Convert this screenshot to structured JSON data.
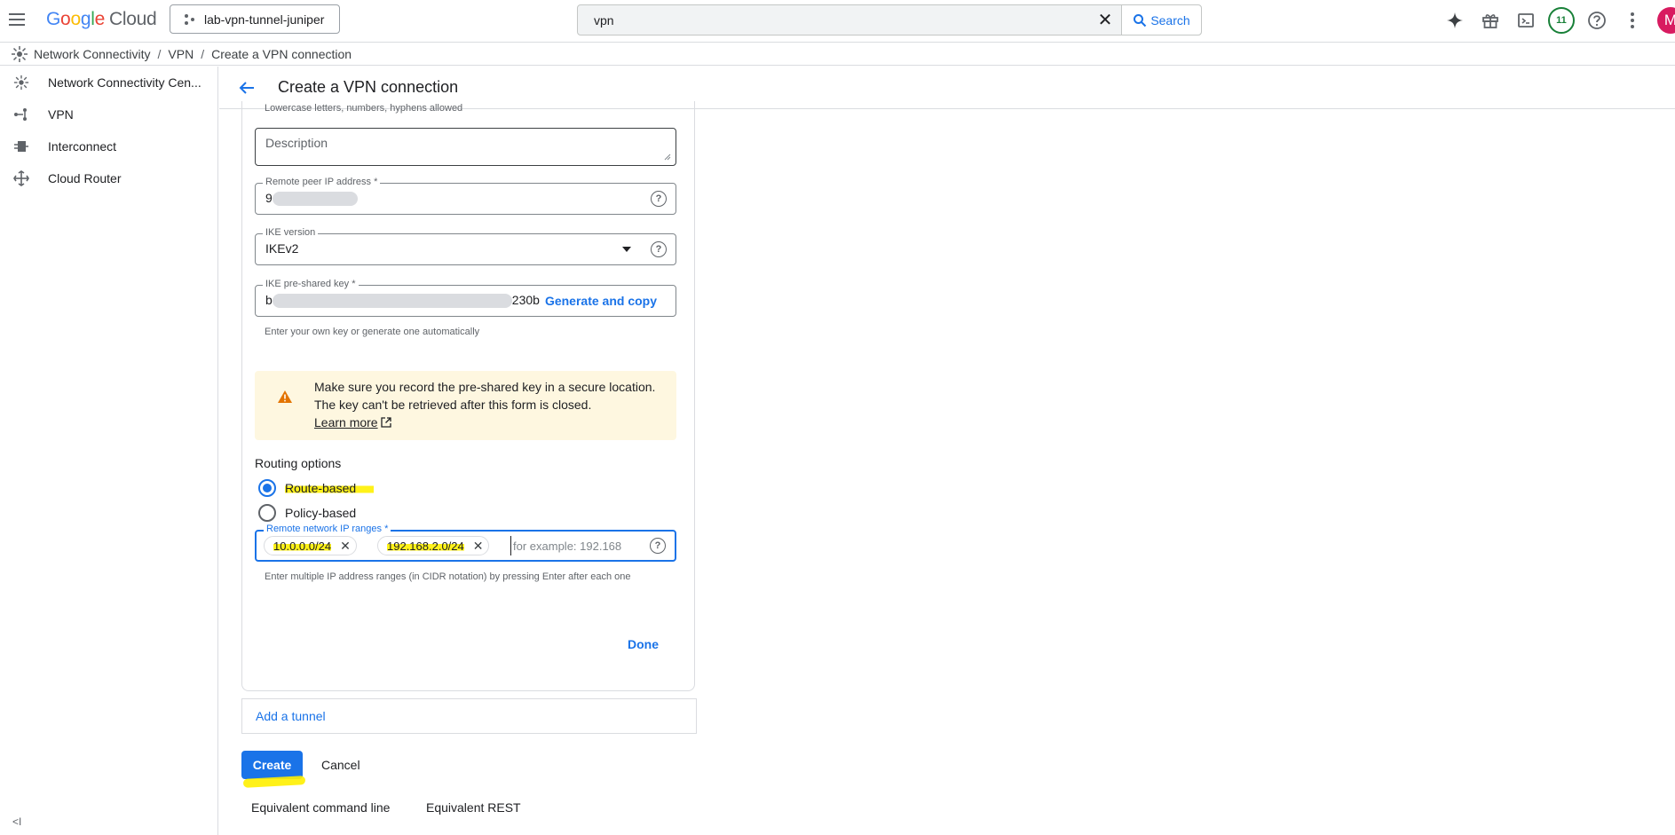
{
  "topbar": {
    "logo_google": [
      "G",
      "o",
      "o",
      "g",
      "l",
      "e"
    ],
    "logo_cloud": "Cloud",
    "project": "lab-vpn-tunnel-juniper",
    "search_value": "vpn",
    "search_button": "Search",
    "notification_count": "11",
    "avatar_initial": "M"
  },
  "breadcrumb": {
    "items": [
      "Network Connectivity",
      "VPN",
      "Create a VPN connection"
    ]
  },
  "sidebar": {
    "items": [
      {
        "label": "Network Connectivity Cen..."
      },
      {
        "label": "VPN"
      },
      {
        "label": "Interconnect"
      },
      {
        "label": "Cloud Router"
      }
    ],
    "collapse_label": "<I"
  },
  "header": {
    "title": "Create a VPN connection"
  },
  "form": {
    "name_hint": "Lowercase letters, numbers, hyphens allowed",
    "description_placeholder": "Description",
    "remote_peer_label": "Remote peer IP address *",
    "remote_peer_value_prefix": "9",
    "ike_version_label": "IKE version",
    "ike_version_value": "IKEv2",
    "psk_label": "IKE pre-shared key *",
    "psk_value_prefix": "b",
    "psk_value_suffix": "230b",
    "generate_copy": "Generate and copy",
    "psk_hint": "Enter your own key or generate one automatically",
    "warning_line1": "Make sure you record the pre-shared key in a secure location.",
    "warning_line2": "The key can't be retrieved after this form is closed.",
    "learn_more": "Learn more",
    "routing_title": "Routing options",
    "route_based": "Route-based",
    "policy_based": "Policy-based",
    "remote_ranges_label": "Remote network IP ranges *",
    "chips": [
      "10.0.0.0/24",
      "192.168.2.0/24"
    ],
    "chip_placeholder": "for example: 192.168",
    "ranges_hint": "Enter multiple IP address ranges (in CIDR notation) by pressing Enter after each one",
    "done": "Done"
  },
  "actions": {
    "add_tunnel": "Add a tunnel",
    "create": "Create",
    "cancel": "Cancel",
    "equiv_cmd": "Equivalent command line",
    "equiv_rest": "Equivalent REST"
  },
  "colors": {
    "primary": "#1a73e8",
    "warning_bg": "#fef7e0",
    "highlight": "#fff000"
  }
}
